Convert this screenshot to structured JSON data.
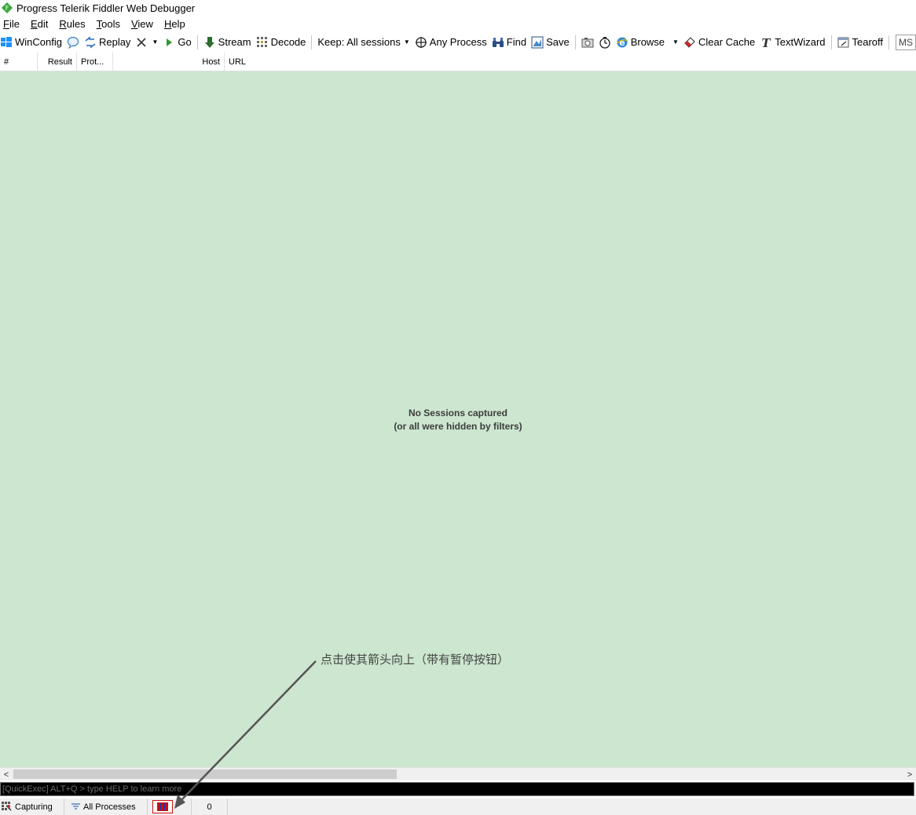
{
  "window": {
    "title": "Progress Telerik Fiddler Web Debugger"
  },
  "menu": {
    "items": [
      {
        "key": "F",
        "rest": "ile"
      },
      {
        "key": "E",
        "rest": "dit"
      },
      {
        "key": "R",
        "rest": "ules"
      },
      {
        "key": "T",
        "rest": "ools"
      },
      {
        "key": "V",
        "rest": "iew"
      },
      {
        "key": "H",
        "rest": "elp"
      }
    ]
  },
  "toolbar": {
    "winconfig": "WinConfig",
    "replay": "Replay",
    "go": "Go",
    "stream": "Stream",
    "decode": "Decode",
    "keep": "Keep: All sessions",
    "any_process": "Any Process",
    "find": "Find",
    "save": "Save",
    "browse": "Browse",
    "clear_cache": "Clear Cache",
    "textwizard": "TextWizard",
    "tearoff": "Tearoff",
    "ms": "MS"
  },
  "columns": [
    "#",
    "Result",
    "Prot...",
    "Host",
    "URL"
  ],
  "sessions": {
    "empty_line1": "No Sessions captured",
    "empty_line2": "(or all were hidden by filters)"
  },
  "annotation": {
    "text": "点击使其箭头向上（带有暂停按钮）"
  },
  "quickexec": {
    "placeholder": "[QuickExec] ALT+Q > type HELP to learn more"
  },
  "status": {
    "capturing": "Capturing",
    "processes": "All Processes",
    "count": "0"
  },
  "colors": {
    "session_bg": "#cde6cf",
    "quickexec_bg": "#000000",
    "annotation_arrow": "#555555",
    "breakpoint_red": "#d01010"
  }
}
